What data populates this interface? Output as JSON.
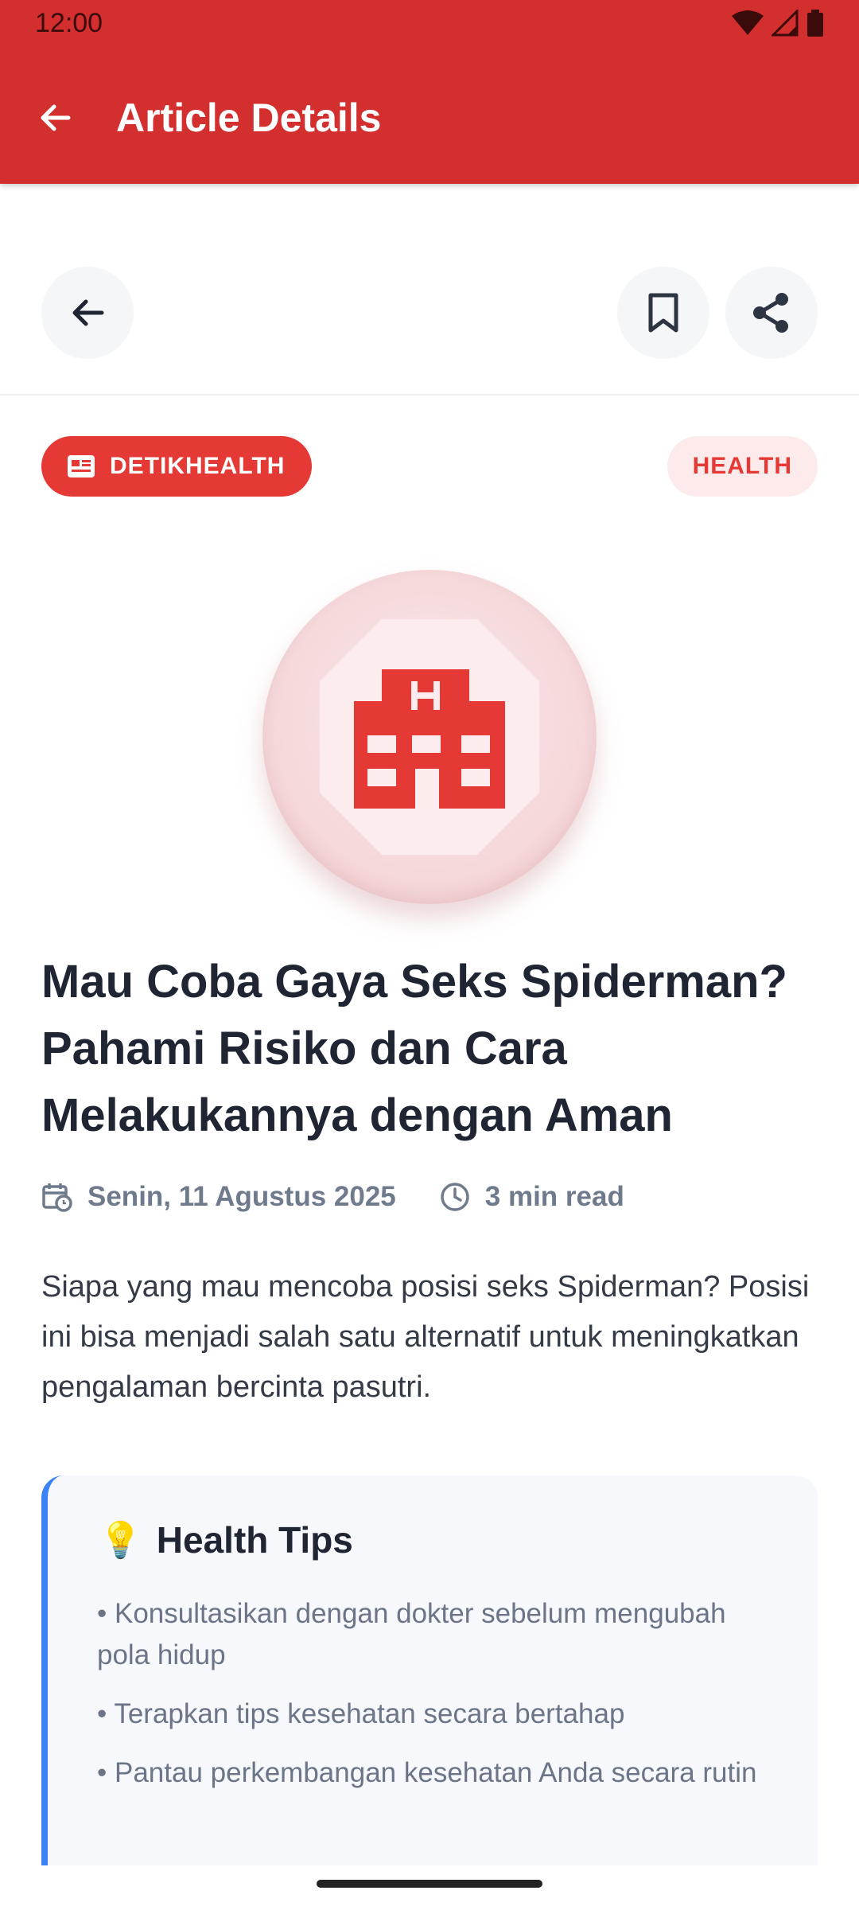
{
  "status_bar": {
    "time": "12:00"
  },
  "app_bar": {
    "title": "Article Details",
    "back_icon": "arrow-left-icon"
  },
  "actions": {
    "back_icon": "arrow-left-icon",
    "bookmark_icon": "bookmark-icon",
    "share_icon": "share-icon"
  },
  "article": {
    "source": "DETIKHEALTH",
    "category": "HEALTH",
    "hero_icon": "hospital-icon",
    "title": "Mau Coba Gaya Seks Spiderman? Pahami Risiko dan Cara Melakukannya dengan Aman",
    "date": "Senin, 11 Agustus 2025",
    "read_time": "3 min read",
    "summary": "Siapa yang mau mencoba posisi seks Spiderman? Posisi ini bisa menjadi salah satu alternatif untuk meningkatkan pengalaman bercinta pasutri."
  },
  "tips": {
    "icon": "💡",
    "title": "Health Tips",
    "items": [
      "• Konsultasikan dengan dokter sebelum mengubah pola hidup",
      "• Terapkan tips kesehatan secara bertahap",
      "• Pantau perkembangan kesehatan Anda secara rutin"
    ]
  },
  "colors": {
    "primary": "#d32f2f",
    "accent": "#e53935",
    "tip_border": "#3b82f6"
  }
}
